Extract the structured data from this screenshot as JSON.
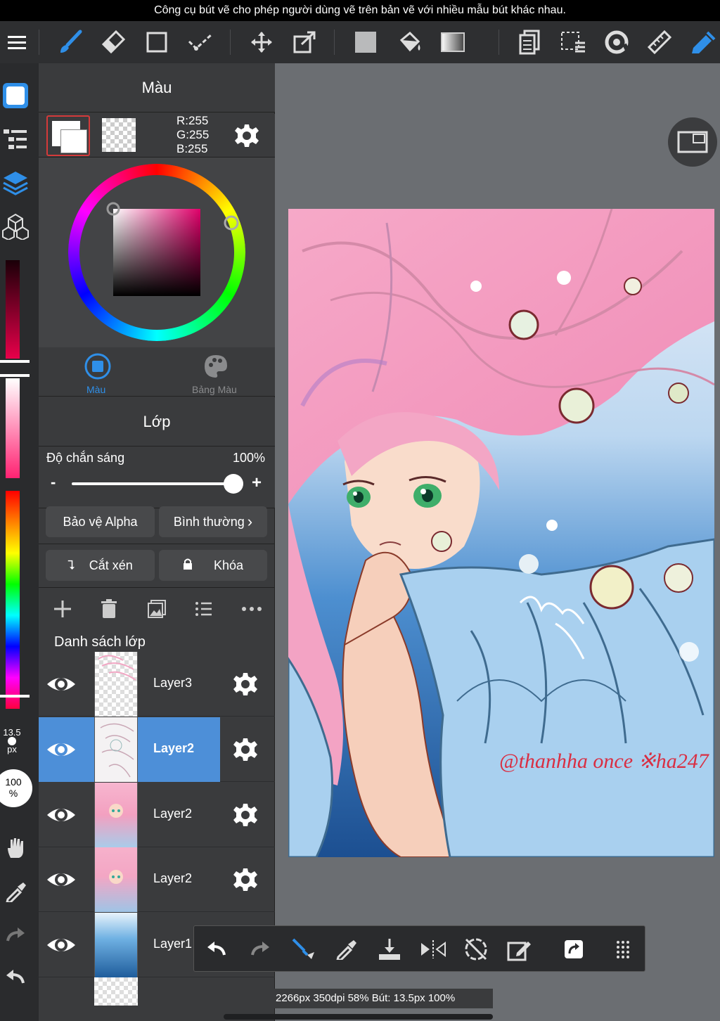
{
  "caption": "Công cụ bút vẽ cho phép người dùng vẽ trên bản vẽ với nhiều mẫu bút khác nhau.",
  "colors": {
    "accent": "#4d8fd8",
    "panel": "#3a3b3d",
    "toolbar": "#2e2f31",
    "icon_blue": "#2f8fe8"
  },
  "toolbar": {
    "items": [
      "menu-icon",
      "brush-icon",
      "eraser-icon",
      "rectangle-icon",
      "selection-pen-icon",
      "move-icon",
      "transform-icon",
      "fill-color-icon",
      "bucket-icon",
      "gradient-icon",
      "layer-copy-icon",
      "select-area-icon",
      "lasso-icon",
      "ruler-icon",
      "snap-icon"
    ]
  },
  "color_panel": {
    "title": "Màu",
    "rgb": {
      "r": "R:255",
      "g": "G:255",
      "b": "B:255"
    },
    "tabs": [
      {
        "label": "Màu"
      },
      {
        "label": "Bảng Màu"
      }
    ]
  },
  "layer_panel": {
    "title": "Lớp",
    "opacity_label": "Độ chắn sáng",
    "opacity_value": "100%",
    "opacity_fraction": 1.0,
    "minus": "-",
    "plus": "+",
    "alpha_button": "Bảo vệ Alpha",
    "blend_button": "Bình thường",
    "clip_button": "Cắt xén",
    "lock_button": "Khóa",
    "list_title": "Danh sách lớp",
    "layers": [
      {
        "name": "Layer3",
        "selected": false
      },
      {
        "name": "Layer2",
        "selected": true
      },
      {
        "name": "Layer2",
        "selected": false
      },
      {
        "name": "Layer2",
        "selected": false
      },
      {
        "name": "Layer1",
        "selected": false
      }
    ]
  },
  "left_strip": {
    "brush_size": "13.5",
    "brush_unit": "px",
    "opacity": "100",
    "opacity_unit": "%"
  },
  "status": "2266px 350dpi 58% Bút: 13.5px 100%",
  "signature": "@thanhha once ※ha247"
}
